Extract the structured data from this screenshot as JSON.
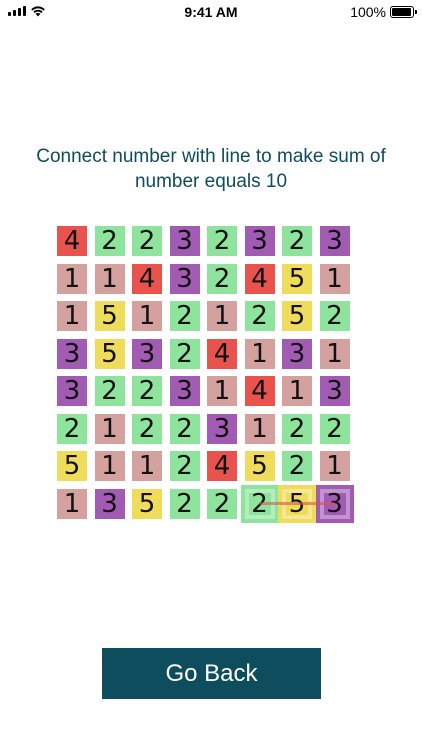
{
  "status_bar": {
    "time": "9:41 AM",
    "battery": "100%",
    "icons": [
      "signal-icon",
      "wifi-icon",
      "battery-icon"
    ]
  },
  "instruction": "Connect number with line to make sum of number equals 10",
  "board": {
    "rows": [
      [
        4,
        2,
        2,
        3,
        2,
        3,
        2,
        3
      ],
      [
        1,
        1,
        4,
        3,
        2,
        4,
        5,
        1
      ],
      [
        1,
        5,
        1,
        2,
        1,
        2,
        5,
        2
      ],
      [
        3,
        5,
        3,
        2,
        4,
        1,
        3,
        1
      ],
      [
        3,
        2,
        2,
        3,
        1,
        4,
        1,
        3
      ],
      [
        2,
        1,
        2,
        2,
        3,
        1,
        2,
        2
      ],
      [
        5,
        1,
        1,
        2,
        4,
        5,
        2,
        1
      ],
      [
        1,
        3,
        5,
        2,
        2,
        2,
        5,
        3
      ]
    ],
    "colors": {
      "1": "#d4a19f",
      "2": "#8ee49d",
      "3": "#a15bb3",
      "4": "#e8544d",
      "5": "#eedc5a"
    },
    "selected_path": [
      [
        7,
        5
      ],
      [
        7,
        6
      ],
      [
        7,
        7
      ]
    ],
    "path_sum": 10
  },
  "go_back_label": "Go Back"
}
